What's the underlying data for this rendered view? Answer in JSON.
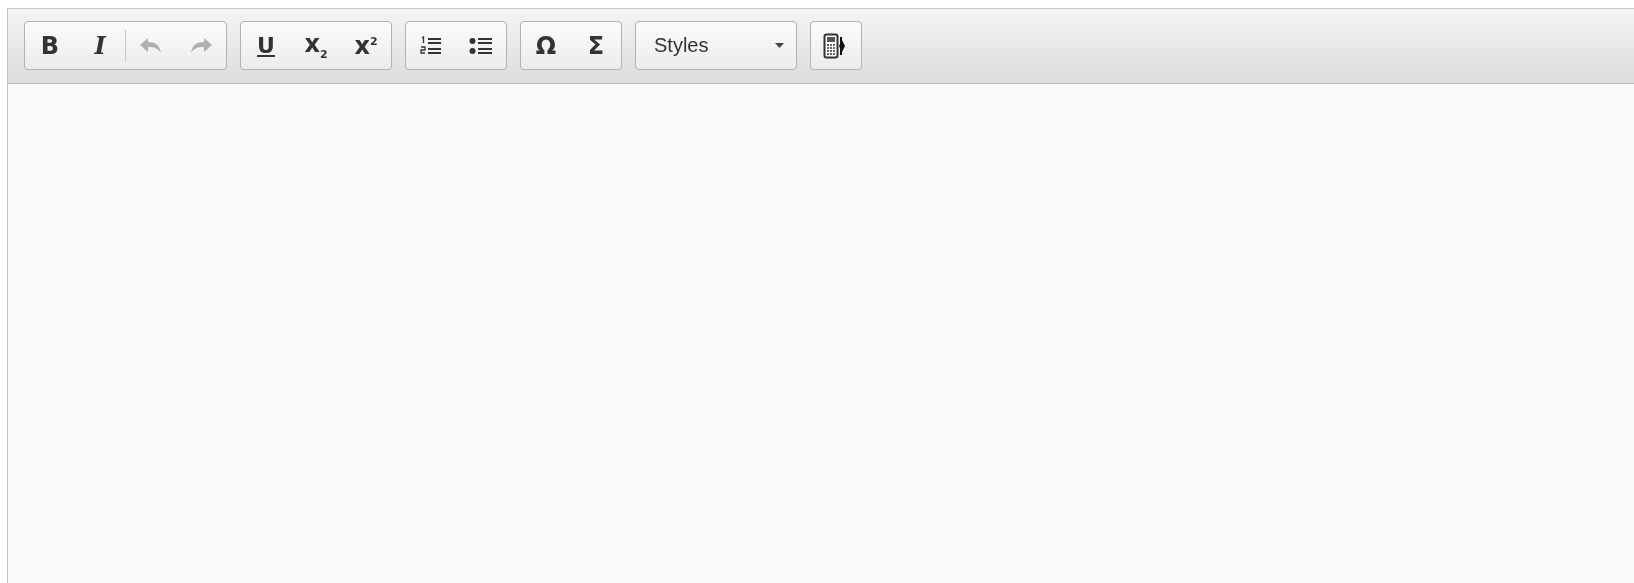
{
  "toolbar": {
    "groups": [
      {
        "buttons": [
          {
            "kind": "bold",
            "label": "B",
            "disabled": false
          },
          {
            "kind": "italic",
            "label": "I",
            "disabled": false
          },
          {
            "kind": "separator"
          },
          {
            "kind": "undo",
            "disabled": true
          },
          {
            "kind": "redo",
            "disabled": true
          }
        ]
      },
      {
        "buttons": [
          {
            "kind": "underline",
            "label": "U",
            "disabled": false
          },
          {
            "kind": "glyph",
            "label": "x$_{2}$",
            "disabled": false
          },
          {
            "kind": "glyph",
            "label": "x$^{2}$",
            "disabled": false
          }
        ]
      },
      {
        "buttons": [
          {
            "kind": "ol",
            "disabled": false
          },
          {
            "kind": "ul",
            "disabled": false
          }
        ]
      },
      {
        "buttons": [
          {
            "kind": "glyph",
            "label": "Ω",
            "disabled": false
          },
          {
            "kind": "glyph",
            "label": "Σ",
            "disabled": false
          }
        ]
      }
    ],
    "styles_dropdown": {
      "value": "Styles"
    },
    "extra_button": {
      "kind": "calculator"
    }
  }
}
